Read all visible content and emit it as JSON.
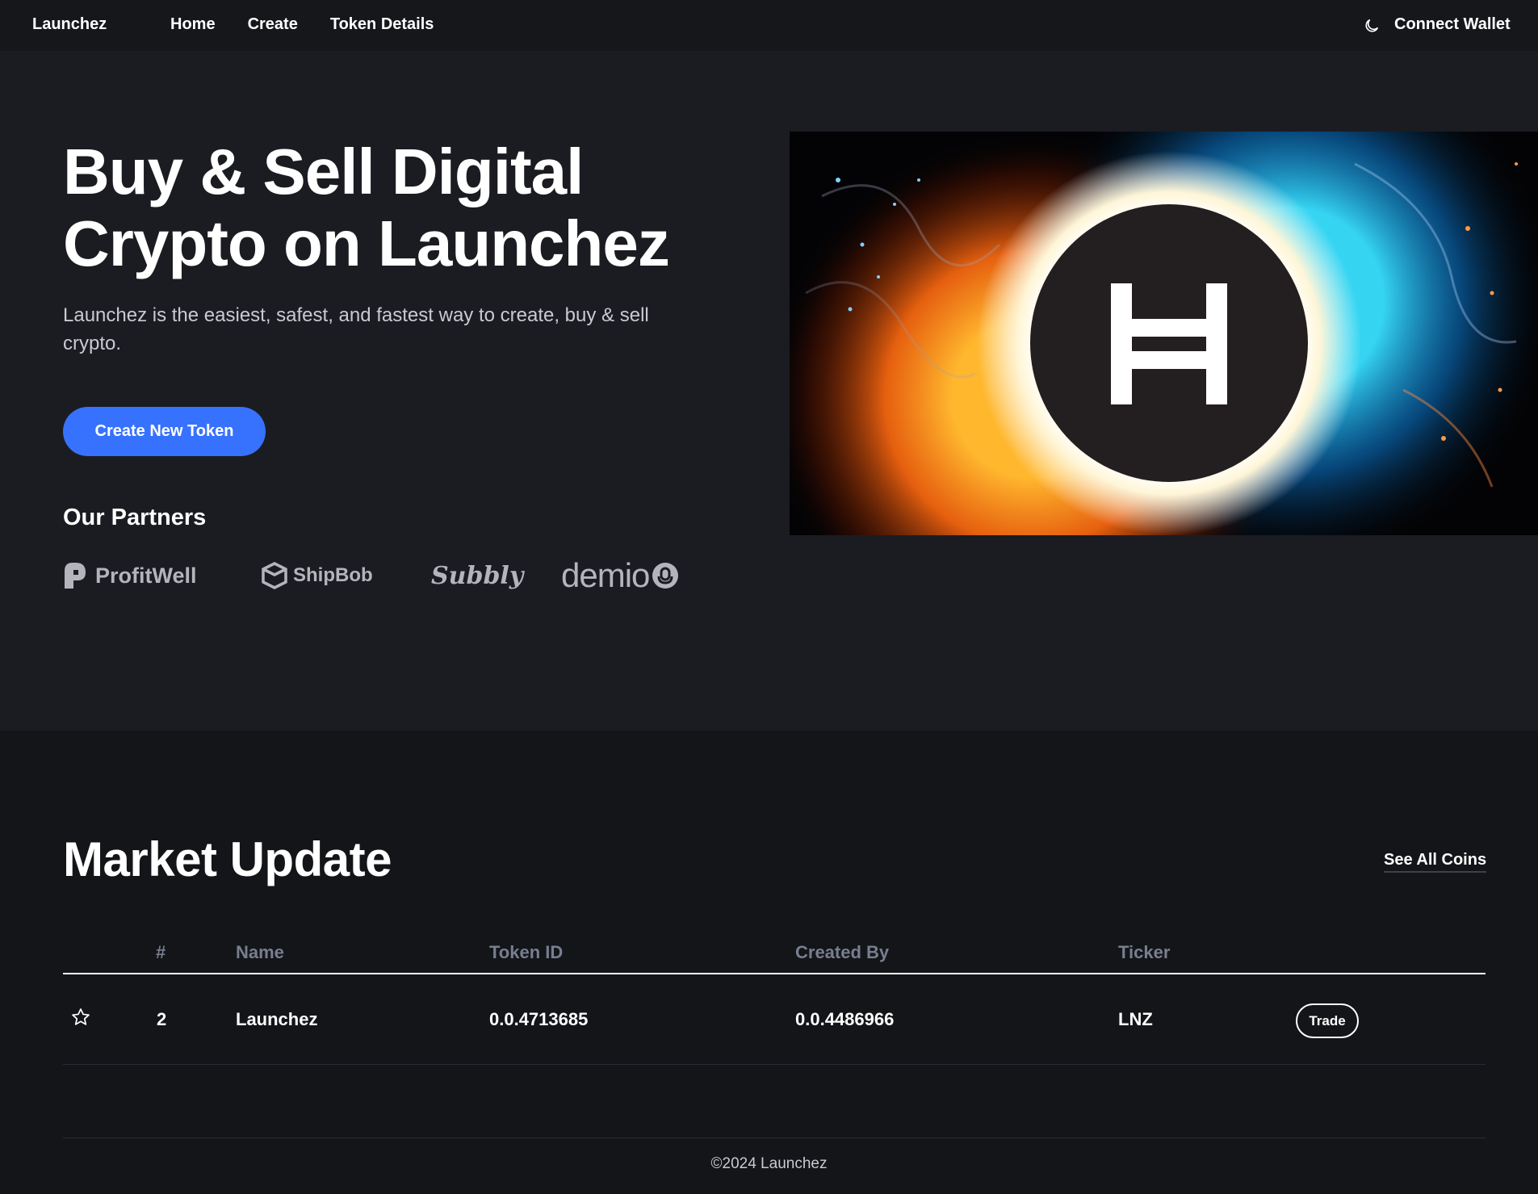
{
  "navbar": {
    "brand": "Launchez",
    "links": [
      "Home",
      "Create",
      "Token Details"
    ],
    "theme_icon": "moon-icon",
    "connect_wallet": "Connect Wallet"
  },
  "hero": {
    "title_line1": "Buy & Sell Digital",
    "title_line2": "Crypto on Launchez",
    "subtitle": "Launchez is the easiest, safest, and fastest way to create, buy & sell crypto.",
    "cta": "Create New Token",
    "partners_title": "Our Partners",
    "partners": [
      "ProfitWell",
      "ShipBob",
      "Subbly",
      "demio"
    ],
    "image_icon": "hedera-logo"
  },
  "market": {
    "title": "Market Update",
    "see_all": "See All Coins",
    "columns": [
      "#",
      "Name",
      "Token ID",
      "Created By",
      "Ticker"
    ],
    "rows": [
      {
        "rank": "2",
        "name": "Launchez",
        "token_id": "0.0.4713685",
        "created_by": "0.0.4486966",
        "ticker": "LNZ",
        "action": "Trade"
      }
    ]
  },
  "footer": {
    "text": "©2024 Launchez"
  },
  "colors": {
    "accent": "#3772ff",
    "background": "#1b1c21",
    "navbar": "#16171b",
    "market_bg": "#141518",
    "muted_text": "#777e90"
  }
}
